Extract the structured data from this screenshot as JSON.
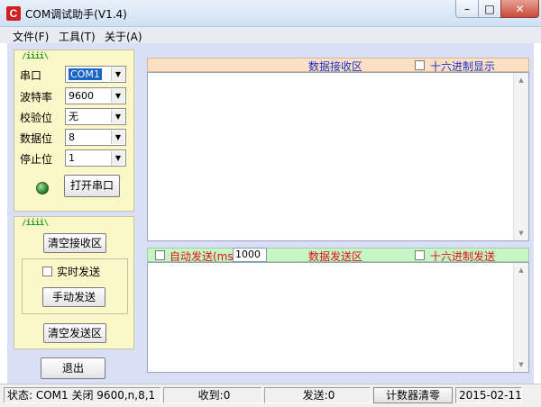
{
  "window": {
    "title": "COM调试助手(V1.4)",
    "app_icon": "C",
    "minimize": "–",
    "maximize": "□",
    "close": "✕"
  },
  "menu": {
    "items": [
      "文件(F)",
      "工具(T)",
      "关于(A)"
    ]
  },
  "serial_panel": {
    "header": "/iiii\\",
    "fields": [
      {
        "label": "串口",
        "value": "COM1"
      },
      {
        "label": "波特率",
        "value": "9600"
      },
      {
        "label": "校验位",
        "value": "无"
      },
      {
        "label": "数据位",
        "value": "8"
      },
      {
        "label": "停止位",
        "value": "1"
      }
    ],
    "open_button": "打开串口",
    "indicator_color": "#1a7a1a"
  },
  "control_panel": {
    "header": "/iiii\\",
    "clear_receive": "清空接收区",
    "realtime_send": "实时发送",
    "manual_send": "手动发送",
    "clear_send": "清空发送区"
  },
  "exit_button": "退出",
  "receive": {
    "title": "数据接收区",
    "hex_display_label": "十六进制显示",
    "header_color": "#fbe0c4"
  },
  "send": {
    "auto_send_label": "自动发送(ms)",
    "interval": "1000",
    "title": "数据发送区",
    "hex_send_label": "十六进制发送",
    "header_color": "#c6f5c6"
  },
  "status": {
    "port_status": "状态: COM1 关闭 9600,n,8,1",
    "received": "收到:0",
    "sent": "发送:0",
    "clear_counter": "计数器清零",
    "date": "2015-02-11"
  },
  "colors": {
    "client_bg": "#d9dff7",
    "panel_bg": "#fbf7c9",
    "label_blue": "#1a2fd0",
    "label_red": "#e01010",
    "label_green": "#1b9b1b"
  }
}
